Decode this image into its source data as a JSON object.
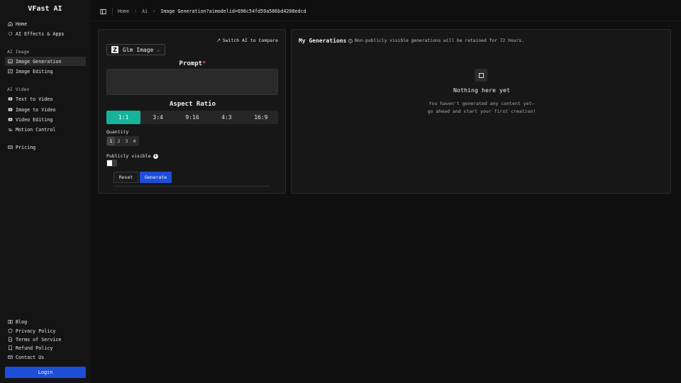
{
  "brand": "VFast AI",
  "nav": {
    "main": [
      {
        "label": "Home",
        "icon": "home-icon"
      },
      {
        "label": "AI Effects & Apps",
        "icon": "sparkle-icon"
      }
    ],
    "image_section": "AI Image",
    "image": [
      {
        "label": "Image Generation",
        "icon": "image-icon"
      },
      {
        "label": "Image Editing",
        "icon": "image-edit-icon"
      }
    ],
    "video_section": "AI Video",
    "video": [
      {
        "label": "Text to Video",
        "icon": "video-icon"
      },
      {
        "label": "Image to Video",
        "icon": "video-icon"
      },
      {
        "label": "Video Editing",
        "icon": "video-edit-icon"
      },
      {
        "label": "Motion Control",
        "icon": "motion-icon"
      }
    ],
    "pricing": {
      "label": "Pricing",
      "icon": "card-icon"
    },
    "footer": [
      {
        "label": "Blog",
        "icon": "book-icon"
      },
      {
        "label": "Privacy Policy",
        "icon": "shield-icon"
      },
      {
        "label": "Terms of Service",
        "icon": "document-icon"
      },
      {
        "label": "Refund Policy",
        "icon": "receipt-icon"
      },
      {
        "label": "Contact Us",
        "icon": "mail-icon"
      }
    ],
    "login": "Login"
  },
  "breadcrumb": {
    "home": "Home",
    "ai": "Ai",
    "current": "Image Generation?aimodelid=696c54fd59a586bd4208edcd"
  },
  "generator": {
    "compare": "Switch AI to Compare",
    "model": "Glm Image",
    "model_logo": "Z",
    "prompt_label": "Prompt",
    "prompt_required": "*",
    "prompt_value": "",
    "aspect_label": "Aspect Ratio",
    "aspect_options": [
      "1:1",
      "3:4",
      "9:16",
      "4:3",
      "16:9"
    ],
    "aspect_selected": "1:1",
    "quantity_label": "Quantity",
    "quantity_options": [
      "1",
      "2",
      "3",
      "4"
    ],
    "quantity_selected": "1",
    "public_label": "Publicly visible",
    "public_on": false,
    "reset": "Reset",
    "generate": "Generate"
  },
  "generations": {
    "title": "My Generations",
    "note": "Non-publicly visible generations will be retained for 72 hours.",
    "empty_title": "Nothing here yet",
    "empty_line1": "You haven't generated any content yet—",
    "empty_line2": "go ahead and start your first creation!"
  },
  "colors": {
    "accent_blue": "#1d4ed8",
    "accent_teal": "#16b39a",
    "required_red": "#ef4444"
  }
}
